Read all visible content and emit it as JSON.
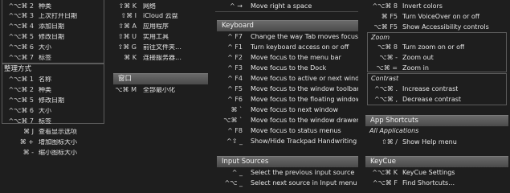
{
  "col1": {
    "top_rows": [
      {
        "key": "^⌥⌘ 2",
        "label": "种类"
      },
      {
        "key": "^⌥⌘ 3",
        "label": "上次打开日期"
      },
      {
        "key": "^⌥⌘ 4",
        "label": "添加日期"
      },
      {
        "key": "^⌥⌘ 5",
        "label": "修改日期"
      },
      {
        "key": "^⌥⌘ 6",
        "label": "大小"
      },
      {
        "key": "^⌥⌘ 7",
        "label": "标签"
      }
    ],
    "section_title": "整理方式",
    "sort_rows": [
      {
        "key": "^⌥⌘ 1",
        "label": "名称"
      },
      {
        "key": "^⌥⌘ 2",
        "label": "种类"
      },
      {
        "key": "^⌥⌘ 5",
        "label": "修改日期"
      },
      {
        "key": "^⌥⌘ 6",
        "label": "大小"
      },
      {
        "key": "^⌥⌘ 7",
        "label": "标签"
      }
    ],
    "bottom_rows": [
      {
        "key": "⌘ J",
        "label": "查看显示选项"
      },
      {
        "key": "⌘ +",
        "label": "增加图标大小"
      },
      {
        "key": "⌘ -",
        "label": "缩小图标大小"
      }
    ]
  },
  "col2": {
    "rows": [
      {
        "key": "⇧⌘ K",
        "label": "网络"
      },
      {
        "key": "⇧⌘ I",
        "label": "iCloud 云盘"
      },
      {
        "key": "⇧⌘ A",
        "label": "应用程序"
      },
      {
        "key": "⇧⌘ U",
        "label": "实用工具"
      },
      {
        "key": "⇧⌘ G",
        "label": "前往文件夹…"
      },
      {
        "key": "⌘ K",
        "label": "连接服务器…"
      }
    ],
    "window_header": "窗口",
    "window_rows": [
      {
        "key": "⌥⌘ M",
        "label": "全部最小化"
      }
    ]
  },
  "col3": {
    "top_row": {
      "key": "^ →",
      "label": "Move right a space"
    },
    "keyboard_header": "Keyboard",
    "keyboard_rows": [
      {
        "key": "^ F7",
        "label": "Change the way Tab moves focus"
      },
      {
        "key": "^ F1",
        "label": "Turn keyboard access on or off"
      },
      {
        "key": "^ F2",
        "label": "Move focus to the menu bar"
      },
      {
        "key": "^ F3",
        "label": "Move focus to the Dock"
      },
      {
        "key": "^ F4",
        "label": "Move focus to active or next wind…"
      },
      {
        "key": "^ F5",
        "label": "Move focus to the window toolbar"
      },
      {
        "key": "^ F6",
        "label": "Move focus to the floating window"
      },
      {
        "key": "⌘ `",
        "label": "Move focus to next window"
      },
      {
        "key": "⌥⌘ `",
        "label": "Move focus to the window drawer"
      },
      {
        "key": "^ F8",
        "label": "Move focus to status menus"
      },
      {
        "key": "^⇧ _",
        "label": "Show/Hide Trackpad Handwriting"
      }
    ],
    "input_header": "Input Sources",
    "input_rows": [
      {
        "key": "^ _",
        "label": "Select the previous input source"
      },
      {
        "key": "^⌥ _",
        "label": "Select next source in Input menu"
      }
    ]
  },
  "col4": {
    "top_rows": [
      {
        "key": "^⌥⌘ 8",
        "label": "Invert colors"
      },
      {
        "key": "⌘ F5",
        "label": "Turn VoiceOver on or off"
      },
      {
        "key": "⌥⌘ F5",
        "label": "Show Accessibility controls"
      }
    ],
    "zoom_title": "Zoom",
    "zoom_rows": [
      {
        "key": "⌥⌘ 8",
        "label": "Turn zoom on or off"
      },
      {
        "key": "⌥⌘ -",
        "label": "Zoom out"
      },
      {
        "key": "⌥⌘ =",
        "label": "Zoom in"
      }
    ],
    "contrast_title": "Contrast",
    "contrast_rows": [
      {
        "key": "^⌥⌘ .",
        "label": "Increase contrast"
      },
      {
        "key": "^⌥⌘ ,",
        "label": "Decrease contrast"
      }
    ],
    "app_header": "App Shortcuts",
    "app_sub": "All Applications",
    "app_rows": [
      {
        "key": "⇧⌘ /",
        "label": "Show Help menu"
      }
    ],
    "keycue_header": "KeyCue",
    "keycue_rows": [
      {
        "key": "^⌥⌘ K",
        "label": "KeyCue Settings"
      },
      {
        "key": "^⌥⌘ F",
        "label": "Find Shortcuts…"
      }
    ]
  }
}
